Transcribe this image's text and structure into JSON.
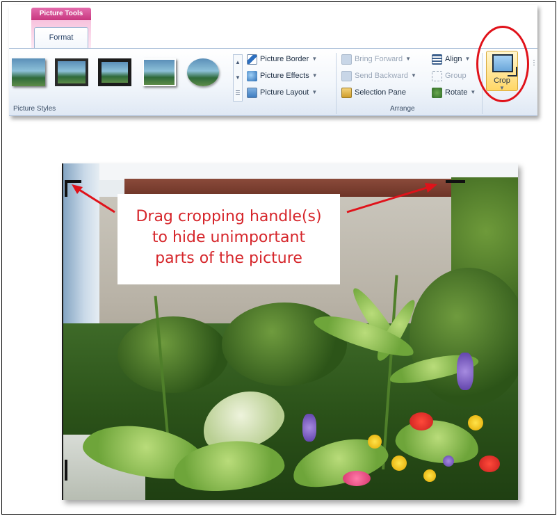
{
  "ribbon": {
    "context_tab": "Picture Tools",
    "active_tab": "Format",
    "groups": {
      "picture_styles": {
        "label": "Picture Styles",
        "commands": {
          "border": "Picture Border",
          "effects": "Picture Effects",
          "layout": "Picture Layout"
        }
      },
      "arrange": {
        "label": "Arrange",
        "commands": {
          "bring_forward": "Bring Forward",
          "send_backward": "Send Backward",
          "selection_pane": "Selection Pane",
          "align": "Align",
          "group": "Group",
          "rotate": "Rotate"
        }
      },
      "size": {
        "crop": "Crop"
      }
    }
  },
  "callout": {
    "line1": "Drag cropping handle(s)",
    "line2": "to hide unimportant",
    "line3": "parts of the picture"
  },
  "colors": {
    "accent_pink": "#c8377f",
    "annotation_red": "#e0121a",
    "callout_text": "#d6262b"
  },
  "icons": [
    "picture-border-icon",
    "picture-effects-icon",
    "picture-layout-icon",
    "bring-forward-icon",
    "send-backward-icon",
    "selection-pane-icon",
    "align-icon",
    "group-icon",
    "rotate-icon",
    "crop-icon"
  ]
}
